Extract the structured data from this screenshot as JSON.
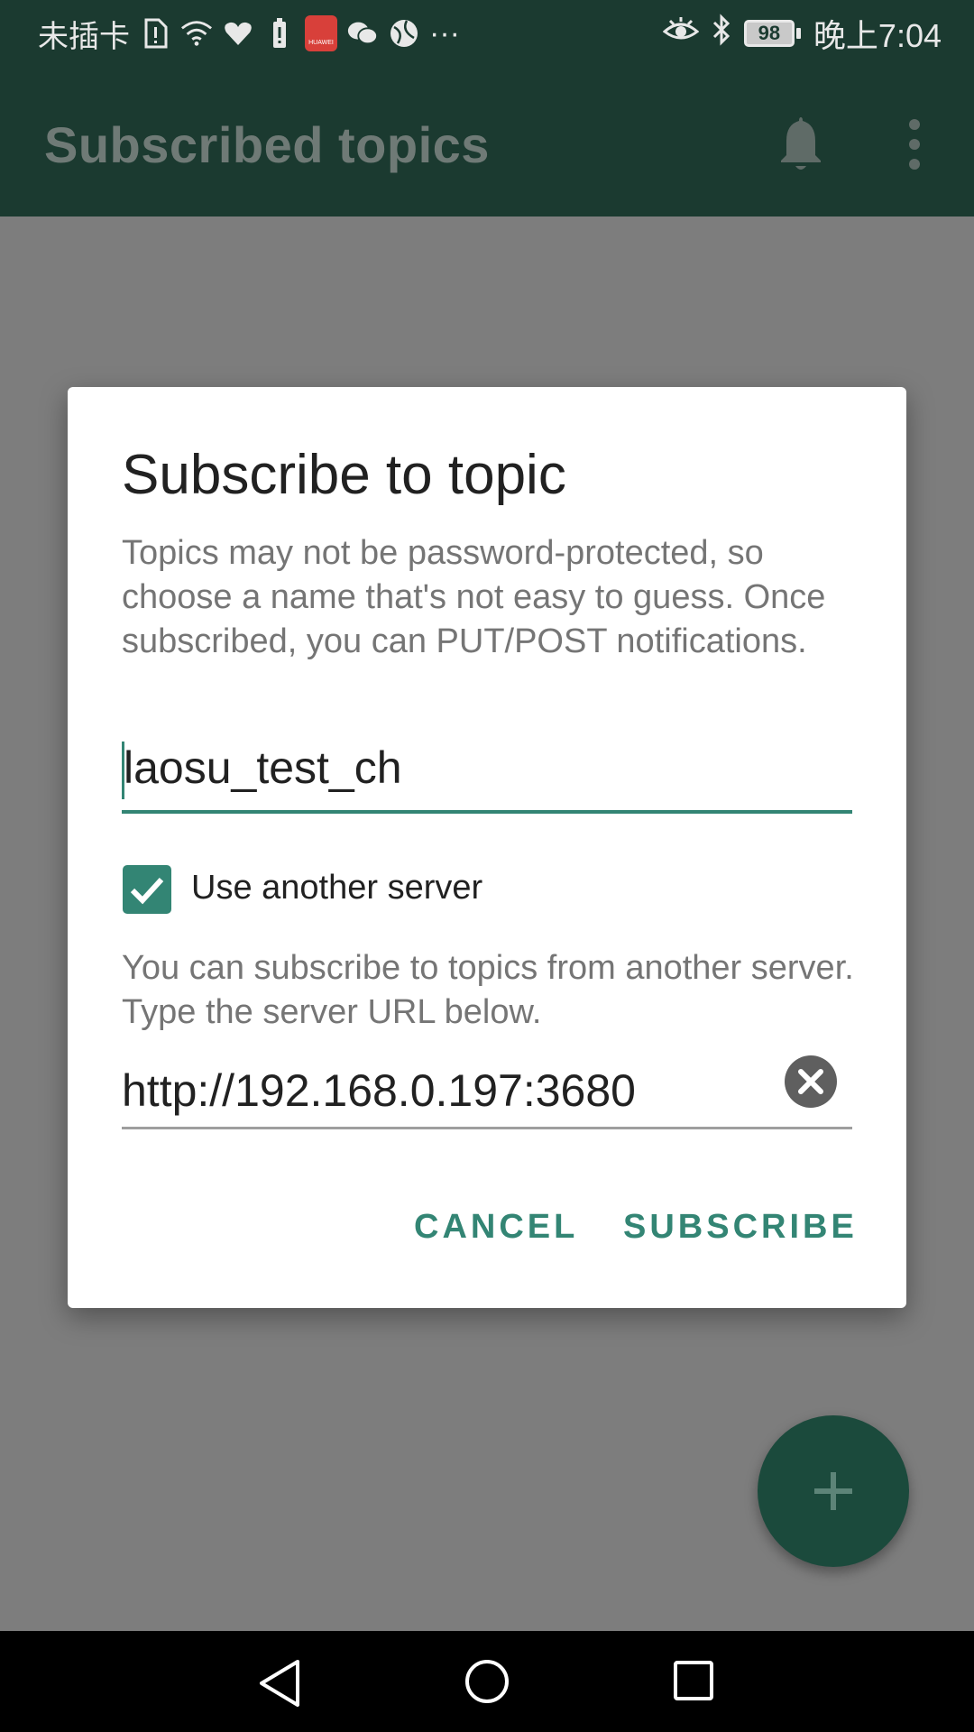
{
  "status_bar": {
    "carrier": "未插卡",
    "more": "···",
    "battery": "98",
    "time": "晚上7:04",
    "left_icons": [
      "sim-alert-icon",
      "wifi-icon",
      "heart-icon",
      "battery-alert-icon",
      "huawei-app-icon",
      "wechat-icon",
      "globe-icon"
    ],
    "right_icons": [
      "eye-icon",
      "bluetooth-icon",
      "battery-icon"
    ]
  },
  "app_bar": {
    "title": "Subscribed topics",
    "icons": [
      "bell-icon",
      "more-vert-icon"
    ]
  },
  "dialog": {
    "title": "Subscribe to topic",
    "description": "Topics may not be password-protected, so choose a name that's not easy to guess. Once subscribed, you can PUT/POST notifications.",
    "topic_value": "laosu_test_ch",
    "checkbox": {
      "label": "Use another server",
      "checked": true
    },
    "server_description": "You can subscribe to topics from another server. Type the server URL below.",
    "server_value": "http://192.168.0.197:3680",
    "cancel_label": "CANCEL",
    "subscribe_label": "SUBSCRIBE"
  },
  "fab": {
    "icon": "add-icon"
  },
  "nav_bar": {
    "icons": [
      "back-icon",
      "home-icon",
      "recents-icon"
    ]
  },
  "colors": {
    "primary": "#338574",
    "app_bar": "#1b3a30",
    "scrim": "#7d7d7d"
  }
}
